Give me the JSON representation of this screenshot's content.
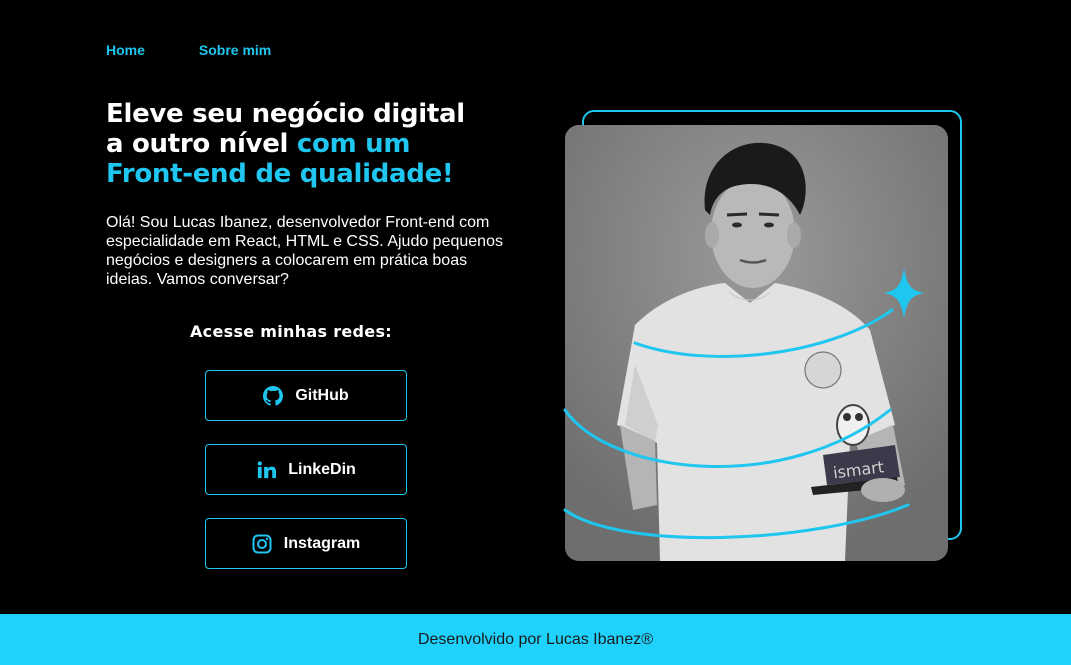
{
  "nav": {
    "home": "Home",
    "about": "Sobre mim"
  },
  "hero": {
    "line1": "Eleve seu negócio digital",
    "line2_white": "a outro nível ",
    "line2_accent": "com um",
    "line3_accent": "Front-end de qualidade!",
    "intro": "Olá! Sou Lucas Ibanez, desenvolvedor Front-end com especialidade em React, HTML e CSS. Ajudo pequenos negócios e designers a colocarem em prática boas ideias. Vamos conversar?"
  },
  "social": {
    "title": "Acesse minhas redes:",
    "buttons": [
      {
        "label": "GitHub",
        "icon": "github-icon"
      },
      {
        "label": "LinkeDin",
        "icon": "linkedin-icon"
      },
      {
        "label": "Instagram",
        "icon": "instagram-icon"
      }
    ]
  },
  "photo": {
    "trophy_text": "ismart"
  },
  "footer": {
    "text": "Desenvolvido por Lucas Ibanez®"
  },
  "colors": {
    "accent": "#1fc6ef",
    "footer_bg": "#1fd2fd",
    "background": "#000000"
  }
}
